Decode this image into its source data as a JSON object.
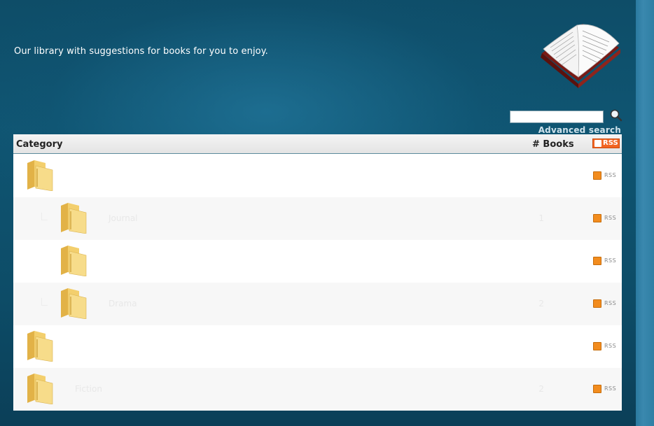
{
  "header": {
    "tagline": "Our library with suggestions for books for you to enjoy."
  },
  "search": {
    "value": "",
    "placeholder": "",
    "advanced_link": "Advanced search"
  },
  "table": {
    "col_category": "Category",
    "col_books": "# Books",
    "rss_header_label": "RSS",
    "rss_row_label": "RSS",
    "rows": [
      {
        "name": "",
        "count": "",
        "indent": 0
      },
      {
        "name": "Journal",
        "count": "1",
        "indent": 1
      },
      {
        "name": "",
        "count": "",
        "indent": 1
      },
      {
        "name": "Drama",
        "count": "2",
        "indent": 1
      },
      {
        "name": "",
        "count": "",
        "indent": 0
      },
      {
        "name": "Fiction",
        "count": "2",
        "indent": 0
      }
    ]
  },
  "colors": {
    "background": "#0f5572",
    "rss_orange": "#f26522",
    "folder_yellow": "#f1cd6a"
  },
  "icons": [
    "open-book-icon",
    "magnifier-icon",
    "rss-icon",
    "folder-icon"
  ]
}
